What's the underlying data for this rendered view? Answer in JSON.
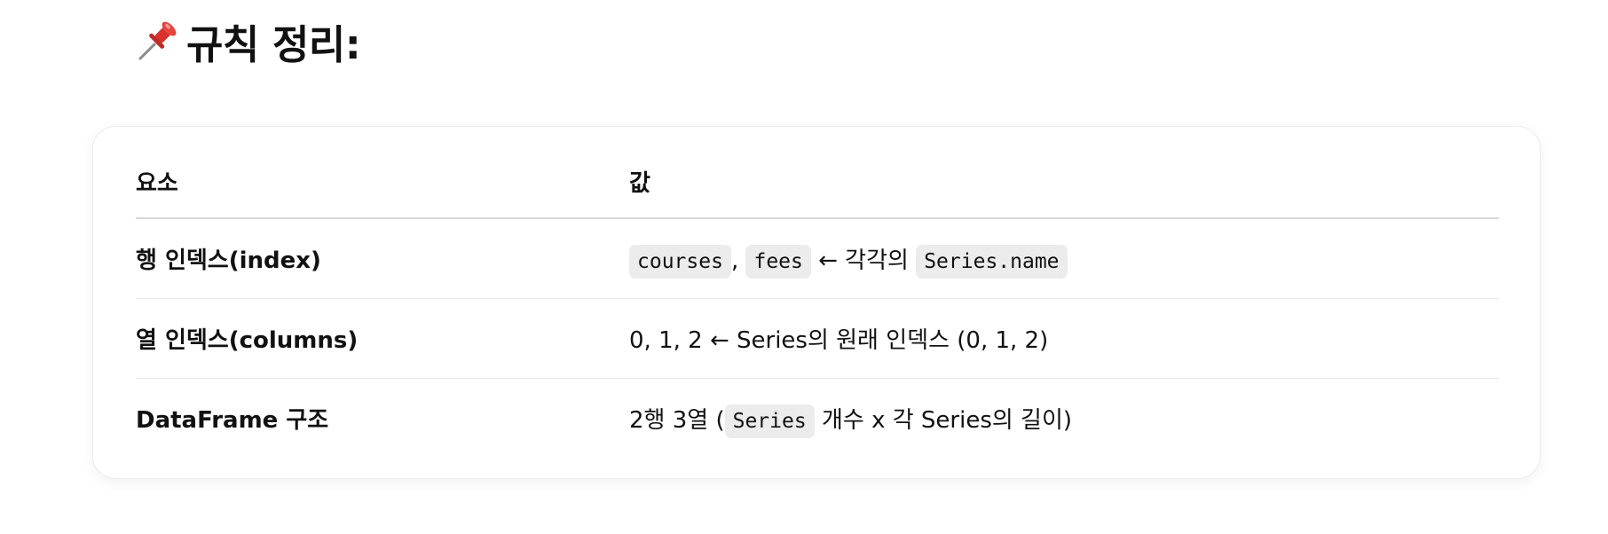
{
  "heading": {
    "icon": "pushpin-icon",
    "text": "규칙 정리:"
  },
  "table": {
    "headers": [
      "요소",
      "값"
    ],
    "rows": [
      {
        "key": "행 인덱스(index)",
        "value": {
          "code1": "courses",
          "sep": ",",
          "code2": "fees",
          "text1": "← 각각의",
          "code3": "Series.name"
        }
      },
      {
        "key": "열 인덱스(columns)",
        "value": {
          "text": "0, 1, 2 ← Series의 원래 인덱스 (0, 1, 2)"
        }
      },
      {
        "key": "DataFrame 구조",
        "value": {
          "text1": "2행 3열 (",
          "code1": "Series",
          "text2": "개수 x 각 Series의 길이)"
        }
      }
    ]
  },
  "colors": {
    "code_background": "#ececec",
    "card_border": "#ececec",
    "header_rule": "#d9d9d9",
    "row_rule": "#e8e8e8"
  }
}
